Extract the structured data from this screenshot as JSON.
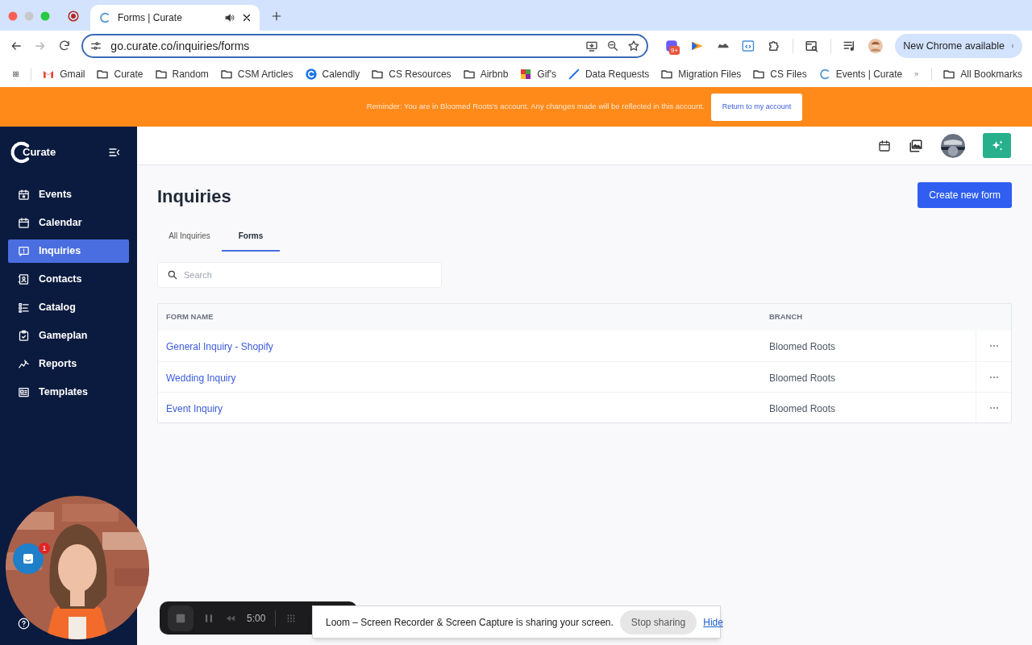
{
  "browser": {
    "tabs": [
      {
        "title": "Forms | Curate",
        "selected": true
      }
    ],
    "url": "go.curate.co/inquiries/forms",
    "extension_badge": "9+",
    "update_button": "New Chrome available",
    "bookmarks": [
      {
        "label": "Gmail",
        "kind": "gmail"
      },
      {
        "label": "Curate",
        "kind": "folder"
      },
      {
        "label": "Random",
        "kind": "folder"
      },
      {
        "label": "CSM Articles",
        "kind": "folder"
      },
      {
        "label": "Calendly",
        "kind": "calendly"
      },
      {
        "label": "CS Resources",
        "kind": "folder"
      },
      {
        "label": "Airbnb",
        "kind": "folder"
      },
      {
        "label": "Gif's",
        "kind": "gifs"
      },
      {
        "label": "Data Requests",
        "kind": "jira"
      },
      {
        "label": "Migration Files",
        "kind": "folder"
      },
      {
        "label": "CS Files",
        "kind": "folder"
      },
      {
        "label": "Events | Curate",
        "kind": "curate"
      }
    ],
    "all_bookmarks": "All Bookmarks"
  },
  "banner": {
    "message": "Reminder: You are in Bloomed Roots's account. Any changes made will be reflected in this account.",
    "button": "Return to my account"
  },
  "sidebar": {
    "logo": "Curate",
    "items": [
      {
        "label": "Events",
        "kind": "events",
        "selected": false
      },
      {
        "label": "Calendar",
        "kind": "calendar",
        "selected": false
      },
      {
        "label": "Inquiries",
        "kind": "inquiries",
        "selected": true
      },
      {
        "label": "Contacts",
        "kind": "contacts",
        "selected": false
      },
      {
        "label": "Catalog",
        "kind": "catalog",
        "selected": false
      },
      {
        "label": "Gameplan",
        "kind": "gameplan",
        "selected": false
      },
      {
        "label": "Reports",
        "kind": "reports",
        "selected": false
      },
      {
        "label": "Templates",
        "kind": "templates",
        "selected": false
      }
    ]
  },
  "page": {
    "title": "Inquiries",
    "create_button": "Create new form",
    "tabs": [
      {
        "label": "All Inquiries",
        "selected": false
      },
      {
        "label": "Forms",
        "selected": true
      }
    ],
    "search": {
      "placeholder": "Search"
    },
    "table": {
      "columns": [
        "FORM NAME",
        "BRANCH"
      ],
      "rows": [
        {
          "form_name": "General Inquiry - Shopify",
          "branch": "Bloomed Roots"
        },
        {
          "form_name": "Wedding Inquiry",
          "branch": "Bloomed Roots"
        },
        {
          "form_name": "Event Inquiry",
          "branch": "Bloomed Roots"
        }
      ]
    }
  },
  "chat_badge": "1",
  "recorder": {
    "time": "5:00"
  },
  "sharing_bar": {
    "message": "Loom – Screen Recorder & Screen Capture is sharing your screen.",
    "stop_button": "Stop sharing",
    "hide_link": "Hide"
  }
}
